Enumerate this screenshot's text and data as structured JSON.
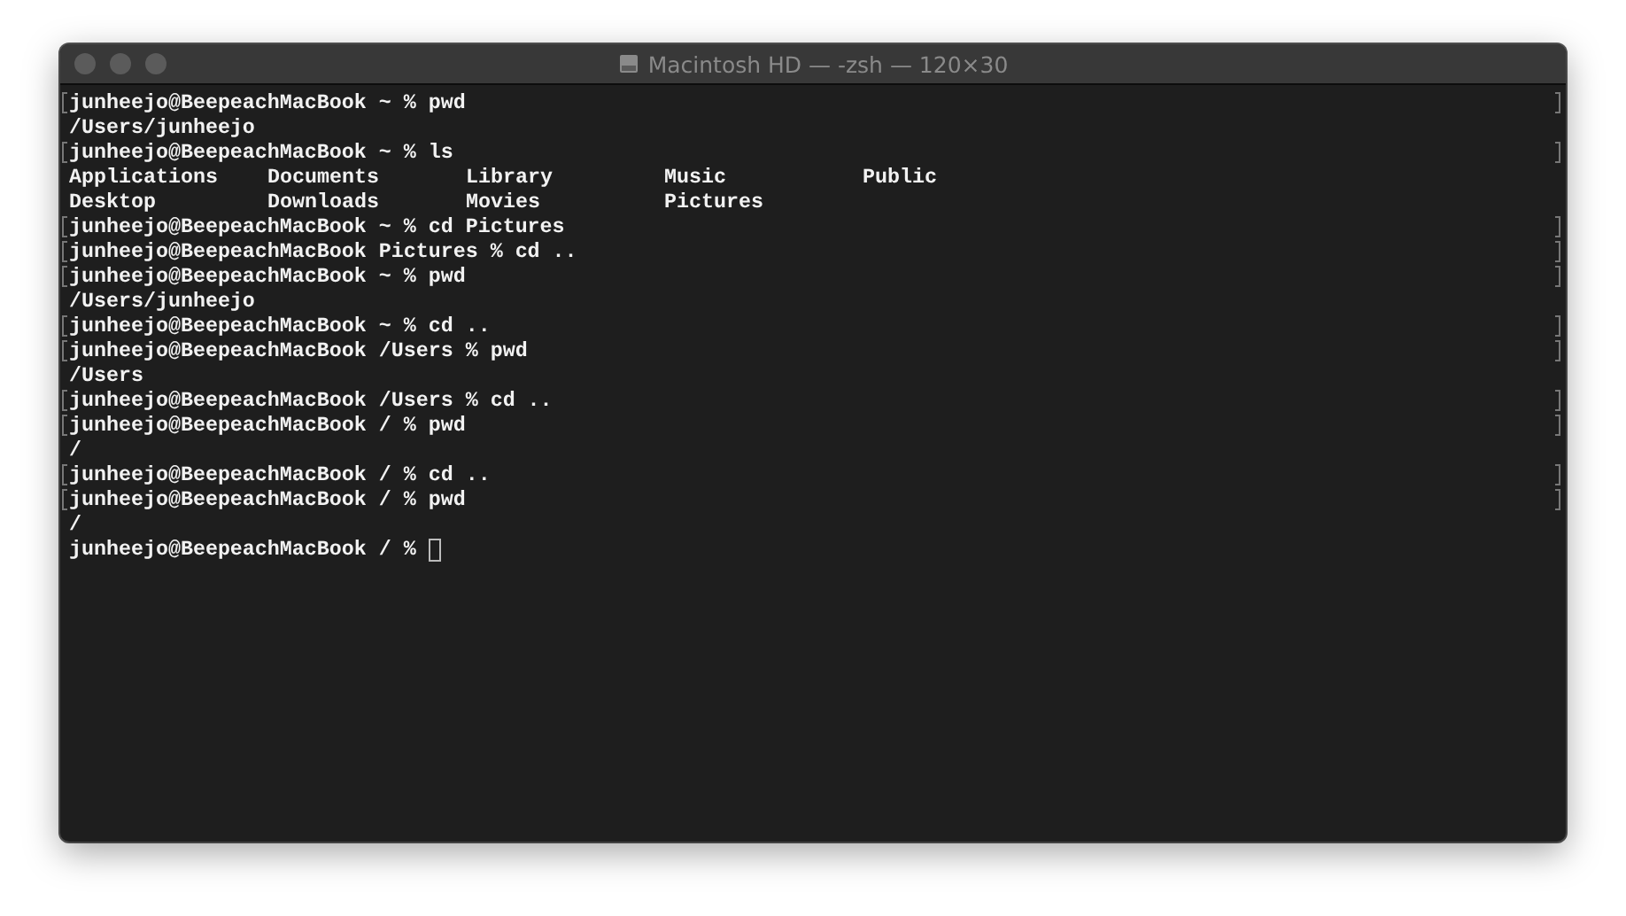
{
  "window": {
    "title": "Macintosh HD — -zsh — 120×30"
  },
  "lines": [
    {
      "kind": "prompt",
      "text": "junheejo@BeepeachMacBook ~ % pwd",
      "marked": true
    },
    {
      "kind": "output",
      "text": "/Users/junheejo",
      "marked": false
    },
    {
      "kind": "prompt",
      "text": "junheejo@BeepeachMacBook ~ % ls",
      "marked": true
    },
    {
      "kind": "columns",
      "cells": [
        "Applications",
        "Documents",
        "Library",
        "Music",
        "Public"
      ],
      "marked": false
    },
    {
      "kind": "columns",
      "cells": [
        "Desktop",
        "Downloads",
        "Movies",
        "Pictures"
      ],
      "marked": false
    },
    {
      "kind": "prompt",
      "text": "junheejo@BeepeachMacBook ~ % cd Pictures",
      "marked": true
    },
    {
      "kind": "prompt",
      "text": "junheejo@BeepeachMacBook Pictures % cd ..",
      "marked": true
    },
    {
      "kind": "prompt",
      "text": "junheejo@BeepeachMacBook ~ % pwd",
      "marked": true
    },
    {
      "kind": "output",
      "text": "/Users/junheejo",
      "marked": false
    },
    {
      "kind": "prompt",
      "text": "junheejo@BeepeachMacBook ~ % cd ..",
      "marked": true
    },
    {
      "kind": "prompt",
      "text": "junheejo@BeepeachMacBook /Users % pwd",
      "marked": true
    },
    {
      "kind": "output",
      "text": "/Users",
      "marked": false
    },
    {
      "kind": "prompt",
      "text": "junheejo@BeepeachMacBook /Users % cd ..",
      "marked": true
    },
    {
      "kind": "prompt",
      "text": "junheejo@BeepeachMacBook / % pwd",
      "marked": true
    },
    {
      "kind": "output",
      "text": "/",
      "marked": false
    },
    {
      "kind": "prompt",
      "text": "junheejo@BeepeachMacBook / % cd ..",
      "marked": true
    },
    {
      "kind": "prompt",
      "text": "junheejo@BeepeachMacBook / % pwd",
      "marked": true
    },
    {
      "kind": "output",
      "text": "/",
      "marked": false
    },
    {
      "kind": "input",
      "text": "junheejo@BeepeachMacBook / % ",
      "marked": false
    }
  ]
}
